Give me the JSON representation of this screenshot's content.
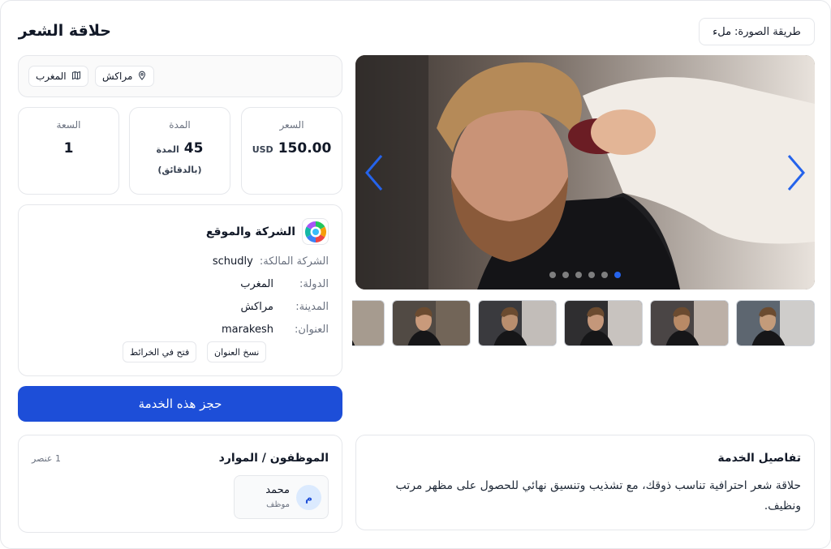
{
  "header": {
    "title": "حلاقة الشعر",
    "image_mode_label": "طريقة الصورة:",
    "image_mode_value": "ملء"
  },
  "location_chips": [
    {
      "label": "المغرب",
      "icon": "map-icon"
    },
    {
      "label": "مراكش",
      "icon": "map-pin-icon"
    }
  ],
  "stats": {
    "price": {
      "label": "السعر",
      "value": "150.00",
      "unit": "USD"
    },
    "duration": {
      "label": "المدة",
      "value": "45",
      "unit": "المدة",
      "sub": "(بالدقائق)"
    },
    "capacity": {
      "label": "السعة",
      "value": "1"
    }
  },
  "company": {
    "title": "الشركة والموقع",
    "owner_label": "الشركة المالكة:",
    "owner_value": "schudly",
    "country_label": "الدولة:",
    "country_value": "المغرب",
    "city_label": "المدينة:",
    "city_value": "مراكش",
    "address_label": "العنوان:",
    "address_value": "marakesh",
    "copy_button": "نسخ العنوان",
    "open_maps_button": "فتح في الخرائط"
  },
  "book_button": "حجز هذه الخدمة",
  "staff": {
    "title": "الموظفون / الموارد",
    "count": "1 عنصر",
    "members": [
      {
        "initial": "م",
        "name": "محمد",
        "role": "موظف"
      }
    ]
  },
  "details": {
    "title": "تفاصيل الخدمة",
    "body": "حلاقة شعر احترافية تناسب ذوقك، مع تشذيب وتنسيق نهائي للحصول على مظهر مرتب ونظيف."
  },
  "gallery": {
    "slide_count": 6,
    "active_slide": 6,
    "thumbnail_count": 6
  },
  "colors": {
    "primary": "#1d4ed8",
    "border": "#e5e7eb",
    "muted_text": "#6b7280",
    "arrow": "#2563eb"
  }
}
